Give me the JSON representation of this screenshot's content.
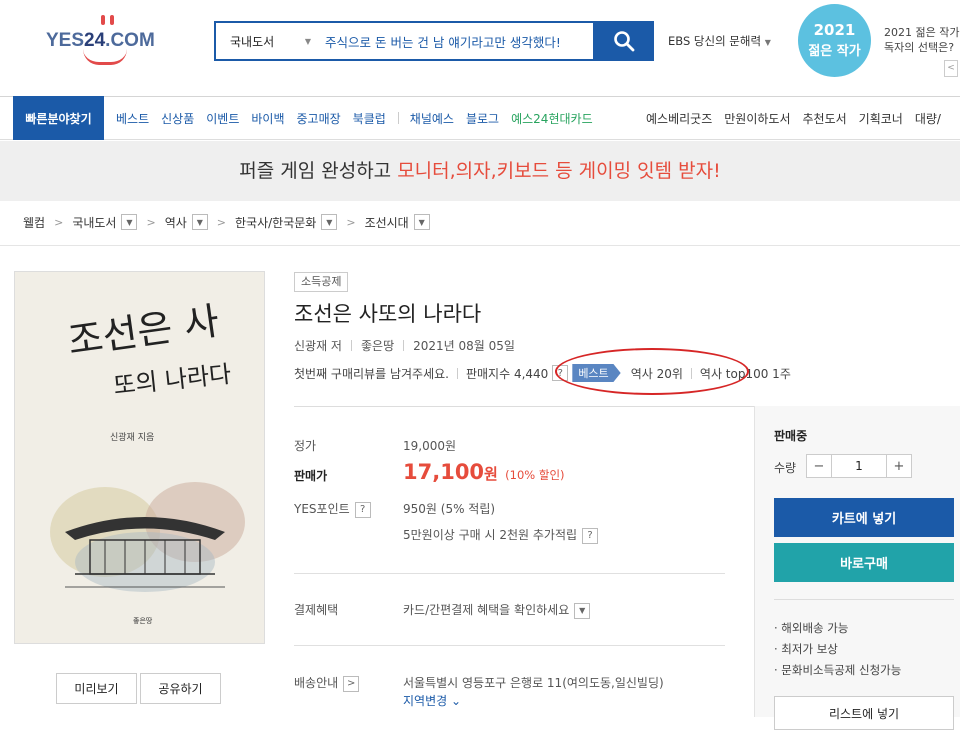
{
  "header": {
    "logo_text_a": "YES",
    "logo_text_b": "24",
    "logo_text_c": ".COM",
    "search_category": "국내도서",
    "search_value": "주식으로 돈 버는 건 남 얘기라고만 생각했다!",
    "ebs_label": "EBS 당신의 문해력",
    "badge_year": "2021",
    "badge_text": "젊은 작가",
    "promo_line1": "2021 젊은 작가",
    "promo_line2": "독자의 선택은?",
    "promo_prev": "<"
  },
  "nav": {
    "quick": "빠른분야찾기",
    "items": [
      "베스트",
      "신상품",
      "이벤트",
      "바이백",
      "중고매장",
      "북클럽",
      "채널예스",
      "블로그",
      "예스24현대카드"
    ],
    "right_items": [
      "예스베리굿즈",
      "만원이하도서",
      "추천도서",
      "기획코너",
      "대량/"
    ]
  },
  "banner": {
    "text_a": "퍼즐 게임 완성하고 ",
    "text_b": "모니터,의자,키보드 등 게이밍 잇템 받자!"
  },
  "breadcrumb": [
    "웰컴",
    "국내도서",
    "역사",
    "한국사/한국문화",
    "조선시대"
  ],
  "book": {
    "tag": "소득공제",
    "title": "조선은 사또의 나라다",
    "author": "신광재 저",
    "publisher": "좋은땅",
    "date": "2021년 08월 05일",
    "review": "첫번째 구매리뷰를 남겨주세요.",
    "sales_index": "판매지수 4,440",
    "best_tag": "베스트",
    "rank1": "역사 20위",
    "rank2": "역사 top100 1주",
    "cover_title1": "조선은 사",
    "cover_title2": "또의 나라다",
    "cover_author": "신광재 지음",
    "cover_pub": "좋은땅"
  },
  "price": {
    "list_label": "정가",
    "list_value": "19,000원",
    "sale_label": "판매가",
    "sale_value": "17,100",
    "sale_unit": "원",
    "sale_discount": "(10% 할인)",
    "point_label": "YES포인트",
    "point_value": "950원 (5% 적립)",
    "point_extra": "5만원이상 구매 시 2천원 추가적립",
    "payment_label": "결제혜택",
    "payment_value": "카드/간편결제 혜택을 확인하세요",
    "ship_label": "배송안내",
    "ship_value": "서울특별시 영등포구 은행로 11(여의도동,일신빌딩)",
    "ship_region": "지역변경"
  },
  "panel": {
    "status": "판매중",
    "qty_label": "수량",
    "qty_value": "1",
    "minus": "−",
    "plus": "+",
    "cart": "카트에 넣기",
    "buy": "바로구매",
    "bullets": [
      "· 해외배송 가능",
      "· 최저가 보상",
      "· 문화비소득공제 신청가능"
    ],
    "list_btn": "리스트에 넣기"
  },
  "buttons": {
    "preview": "미리보기",
    "share": "공유하기",
    "q": "?"
  }
}
